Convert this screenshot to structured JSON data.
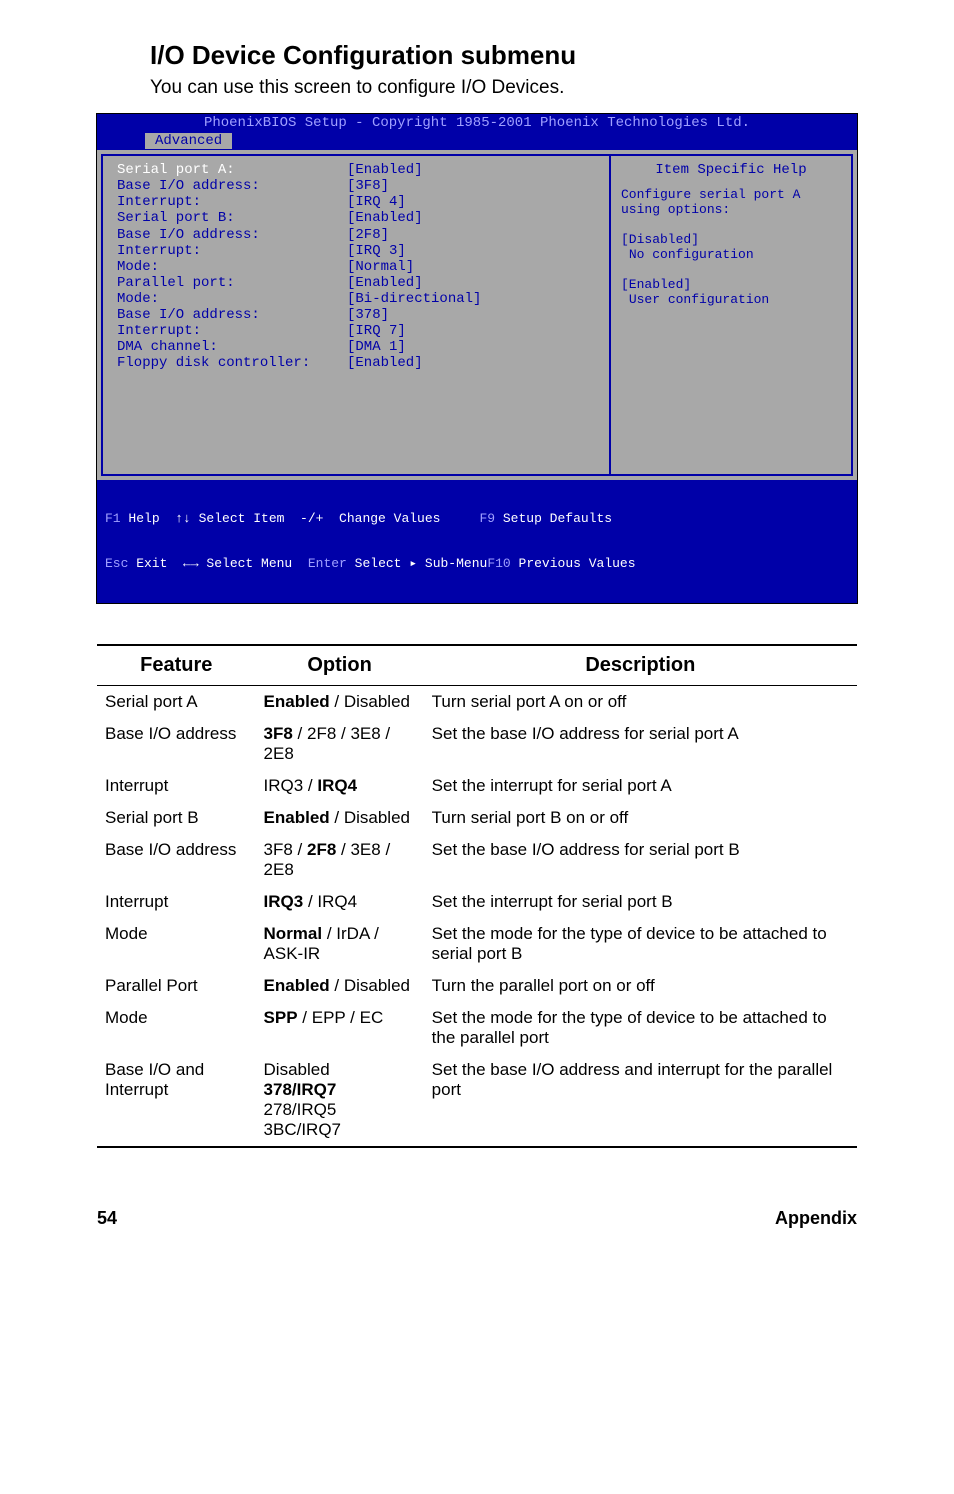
{
  "heading": "I/O Device Configuration submenu",
  "subtitle": "You can use this screen to configure I/O Devices.",
  "bios": {
    "title": "PhoenixBIOS Setup - Copyright 1985-2001 Phoenix Technologies Ltd.",
    "tab": "Advanced",
    "rows": [
      {
        "label": "Serial port A:",
        "value": "[Enabled]",
        "sel": true
      },
      {
        "label": "Base I/O address:",
        "value": "[3F8]"
      },
      {
        "label": "Interrupt:",
        "value": "[IRQ 4]"
      },
      {
        "label": "",
        "value": ""
      },
      {
        "label": "Serial port B:",
        "value": "[Enabled]"
      },
      {
        "label": "Base I/O address:",
        "value": "[2F8]"
      },
      {
        "label": "Interrupt:",
        "value": "[IRQ 3]"
      },
      {
        "label": "Mode:",
        "value": "[Normal]"
      },
      {
        "label": "",
        "value": ""
      },
      {
        "label": "Parallel port:",
        "value": "[Enabled]"
      },
      {
        "label": "Mode:",
        "value": "[Bi-directional]"
      },
      {
        "label": "Base I/O address:",
        "value": "[378]"
      },
      {
        "label": "Interrupt:",
        "value": "[IRQ 7]"
      },
      {
        "label": "DMA channel:",
        "value": "[DMA 1]"
      },
      {
        "label": "",
        "value": ""
      },
      {
        "label": "Floppy disk controller:",
        "value": "[Enabled]"
      }
    ],
    "help_title": "Item Specific Help",
    "help_body": "Configure serial port A\nusing options:\n\n[Disabled]\n No configuration\n\n[Enabled]\n User configuration",
    "footer1_a": "F1",
    "footer1_b": " Help  ↑↓ Select Item  -/+  Change Values     ",
    "footer1_c": "F9",
    "footer1_d": " Setup Defaults",
    "footer2_a": "Esc",
    "footer2_b": " Exit  ←→ Select Menu  ",
    "footer2_c": "Enter",
    "footer2_d": " Select ▸ Sub-Menu",
    "footer2_e": "F10",
    "footer2_f": " Previous Values"
  },
  "table": {
    "h1": "Feature",
    "h2": "Option",
    "h3": "Description",
    "rows": [
      {
        "f": "Serial port A",
        "o": "<b>Enabled</b> / Disabled",
        "d": "Turn serial port A on or off",
        "sep": true
      },
      {
        "f": "Base I/O address",
        "o": "<b>3F8</b> / 2F8 / 3E8 / 2E8",
        "d": "Set the base I/O address for serial port A"
      },
      {
        "f": "Interrupt",
        "o": "IRQ3 / <b>IRQ4</b>",
        "d": "Set the interrupt for serial port A"
      },
      {
        "f": "Serial port B",
        "o": "<b>Enabled</b> / Disabled",
        "d": "Turn serial port B on or off"
      },
      {
        "f": "Base I/O address",
        "o": "3F8 / <b>2F8</b> / 3E8 / 2E8",
        "d": "Set the base I/O address for serial port B"
      },
      {
        "f": "Interrupt",
        "o": "<b>IRQ3</b> / IRQ4",
        "d": "Set the interrupt for serial port B"
      },
      {
        "f": "Mode",
        "o": "<b>Normal</b> / IrDA / ASK-IR",
        "d": "Set the mode for the type of device to be attached to serial port B"
      },
      {
        "f": "Parallel Port",
        "o": "<b>Enabled</b> / Disabled",
        "d": "Turn the parallel port on or off"
      },
      {
        "f": "Mode",
        "o": "<b>SPP</b> / EPP / EC",
        "d": "Set the mode for the type of device to be attached to the parallel port"
      },
      {
        "f": "Base I/O and Interrupt",
        "o": "Disabled<br><b>378/IRQ7</b><br>278/IRQ5 3BC/IRQ7",
        "d": "Set the base I/O address and interrupt for the parallel port",
        "last": true
      }
    ]
  },
  "footer": {
    "page": "54",
    "section": "Appendix"
  }
}
